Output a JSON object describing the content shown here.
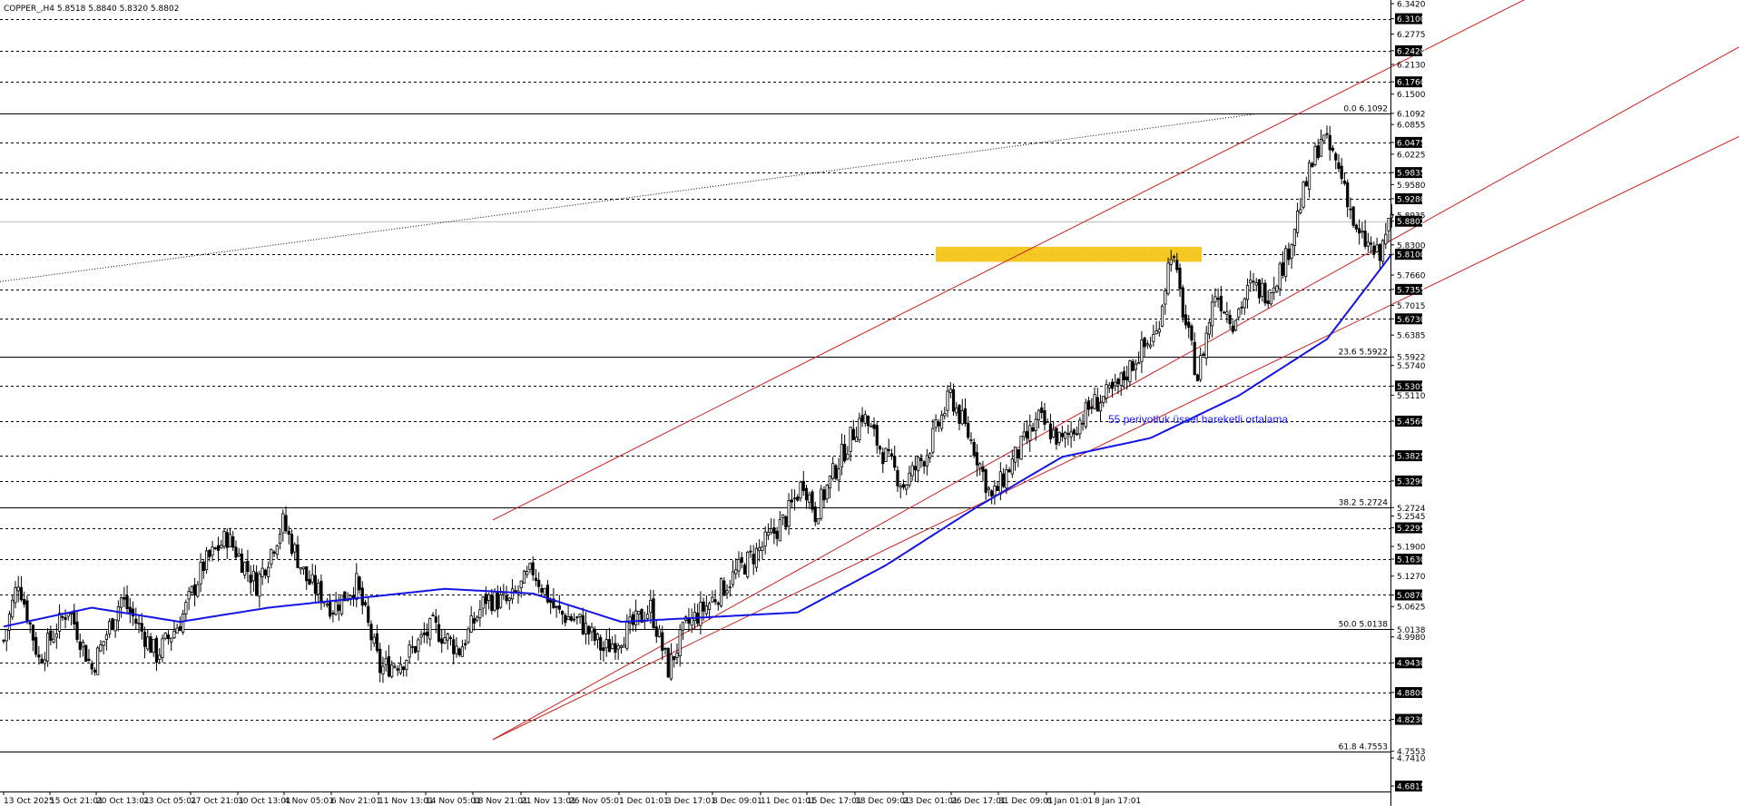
{
  "window": {
    "symbol_header": "COPPER_,H4  5.8518 5.8840 5.8320 5.8802"
  },
  "colors": {
    "background": "#ffffff",
    "candle": "#000000",
    "ema": "#1414e6",
    "channel": "#cc1f1f",
    "highlight_zone": "#f5c518",
    "fib_line": "#000000",
    "grid_dash": "#000000"
  },
  "annotation": {
    "text": "55 periyotluk üssel hareketli ortalama"
  },
  "chart_data": {
    "type": "candlestick",
    "instrument": "COPPER_",
    "timeframe": "H4",
    "ohlc_header": {
      "open": 5.8518,
      "high": 5.884,
      "low": 5.832,
      "close": 5.8802
    },
    "y_range": [
      4.6815,
      6.342
    ],
    "price_scale_ticks": [
      "6.3420",
      "6.3100",
      "6.2775",
      "6.2420",
      "6.2130",
      "6.1760",
      "6.1500",
      "6.1092",
      "6.0855",
      "6.0475",
      "6.0225",
      "5.9835",
      "5.9580",
      "5.9280",
      "5.8935",
      "5.8802",
      "5.8300",
      "5.8100",
      "5.7660",
      "5.7355",
      "5.7015",
      "5.6730",
      "5.6385",
      "5.5922",
      "5.5740",
      "5.5305",
      "5.5110",
      "5.4560",
      "5.3825",
      "5.3290",
      "5.2724",
      "5.2545",
      "5.2295",
      "5.1900",
      "5.1630",
      "5.1270",
      "5.0870",
      "5.0625",
      "5.0138",
      "4.9980",
      "4.9430",
      "4.8800",
      "4.8230",
      "4.7553",
      "4.7410",
      "4.6815"
    ],
    "highlighted_price_labels": [
      "6.3100",
      "6.2420",
      "6.1760",
      "6.0475",
      "5.9835",
      "5.9280",
      "5.8802",
      "5.8100",
      "5.7355",
      "5.6730",
      "5.5305",
      "5.4560",
      "5.3825",
      "5.3290",
      "5.2295",
      "5.1630",
      "5.0870",
      "4.9430",
      "4.8800",
      "4.8230",
      "4.6815"
    ],
    "dashed_levels": [
      6.31,
      6.242,
      6.176,
      6.0475,
      5.9835,
      5.928,
      5.81,
      5.7355,
      5.673,
      5.5305,
      5.456,
      5.3825,
      5.329,
      5.2295,
      5.163,
      5.087,
      4.943,
      4.88,
      4.823
    ],
    "current_price_level": 5.8802,
    "fibonacci_levels": [
      {
        "label": "0.0 6.1092",
        "value": 6.1092
      },
      {
        "label": "23.6 5.5922",
        "value": 5.5922
      },
      {
        "label": "38.2 5.2724",
        "value": 5.2724
      },
      {
        "label": "50.0 5.0138",
        "value": 5.0138
      },
      {
        "label": "61.8 4.7553",
        "value": 4.7553
      }
    ],
    "support_zone": {
      "from": 5.794,
      "to": 5.826
    },
    "time_labels": [
      "13 Oct 2025",
      "15 Oct 21:01",
      "20 Oct 13:01",
      "23 Oct 05:01",
      "27 Oct 21:01",
      "30 Oct 13:01",
      "4 Nov 05:01",
      "6 Nov 21:01",
      "11 Nov 13:01",
      "14 Nov 05:01",
      "18 Nov 21:01",
      "21 Nov 13:01",
      "26 Nov 05:01",
      "1 Dec 01:01",
      "3 Dec 17:01",
      "8 Dec 09:01",
      "11 Dec 01:01",
      "15 Dec 17:01",
      "18 Dec 09:01",
      "23 Dec 01:01",
      "26 Dec 17:01",
      "31 Dec 09:01",
      "6 Jan 01:01",
      "8 Jan 17:01"
    ],
    "bar_count": 360,
    "price_path_closes": [
      [
        0,
        4.99
      ],
      [
        5,
        5.12
      ],
      [
        12,
        4.95
      ],
      [
        22,
        5.06
      ],
      [
        30,
        4.93
      ],
      [
        40,
        5.08
      ],
      [
        52,
        4.96
      ],
      [
        60,
        5.03
      ],
      [
        68,
        5.15
      ],
      [
        76,
        5.21
      ],
      [
        86,
        5.11
      ],
      [
        95,
        5.24
      ],
      [
        103,
        5.12
      ],
      [
        112,
        5.06
      ],
      [
        120,
        5.11
      ],
      [
        128,
        4.93
      ],
      [
        136,
        4.95
      ],
      [
        146,
        5.02
      ],
      [
        155,
        4.97
      ],
      [
        164,
        5.08
      ],
      [
        172,
        5.07
      ],
      [
        180,
        5.14
      ],
      [
        188,
        5.05
      ],
      [
        196,
        5.03
      ],
      [
        204,
        4.97
      ],
      [
        212,
        5.01
      ],
      [
        220,
        5.06
      ],
      [
        226,
        4.93
      ],
      [
        232,
        5.02
      ],
      [
        240,
        5.07
      ],
      [
        250,
        5.14
      ],
      [
        258,
        5.19
      ],
      [
        266,
        5.25
      ],
      [
        272,
        5.33
      ],
      [
        276,
        5.26
      ],
      [
        284,
        5.37
      ],
      [
        292,
        5.47
      ],
      [
        298,
        5.4
      ],
      [
        306,
        5.32
      ],
      [
        314,
        5.39
      ],
      [
        322,
        5.51
      ],
      [
        330,
        5.4
      ],
      [
        336,
        5.29
      ],
      [
        344,
        5.38
      ],
      [
        352,
        5.46
      ],
      [
        360,
        5.41
      ],
      [
        370,
        5.49
      ],
      [
        378,
        5.52
      ],
      [
        386,
        5.6
      ],
      [
        392,
        5.64
      ],
      [
        397,
        5.82
      ],
      [
        402,
        5.66
      ],
      [
        406,
        5.55
      ],
      [
        412,
        5.73
      ],
      [
        418,
        5.67
      ],
      [
        424,
        5.74
      ],
      [
        430,
        5.73
      ],
      [
        436,
        5.8
      ],
      [
        442,
        5.94
      ],
      [
        448,
        6.06
      ],
      [
        452,
        6.02
      ],
      [
        456,
        5.96
      ],
      [
        460,
        5.85
      ],
      [
        464,
        5.83
      ],
      [
        468,
        5.8
      ],
      [
        470,
        5.86
      ],
      [
        472,
        5.8802
      ]
    ],
    "ema55_path": [
      [
        0,
        5.02
      ],
      [
        30,
        5.06
      ],
      [
        60,
        5.03
      ],
      [
        90,
        5.06
      ],
      [
        120,
        5.08
      ],
      [
        150,
        5.1
      ],
      [
        180,
        5.09
      ],
      [
        210,
        5.03
      ],
      [
        240,
        5.04
      ],
      [
        270,
        5.05
      ],
      [
        300,
        5.15
      ],
      [
        330,
        5.27
      ],
      [
        360,
        5.38
      ],
      [
        390,
        5.42
      ],
      [
        420,
        5.51
      ],
      [
        450,
        5.63
      ],
      [
        472,
        5.81
      ]
    ],
    "channel_lines": [
      {
        "name": "upper",
        "from": [
          720,
          5.246
        ],
        "to": [
          1916,
          6.58
        ]
      },
      {
        "name": "middle",
        "from": [
          720,
          4.78
        ],
        "to": [
          1916,
          6.25
        ]
      },
      {
        "name": "lower",
        "from": [
          720,
          4.78
        ],
        "to": [
          1916,
          6.06
        ]
      }
    ],
    "dotted_trendline": {
      "from": [
        0,
        5.752
      ],
      "to": [
        1388,
        6.109
      ]
    }
  }
}
